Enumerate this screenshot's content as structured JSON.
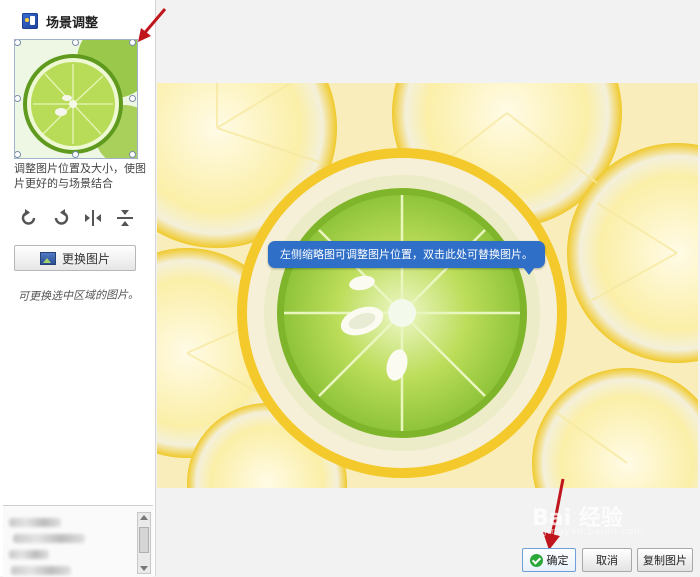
{
  "sidebar": {
    "title": "场景调整",
    "help_text": "调整图片位置及大小，使图片更好的与场景结合",
    "tools": [
      {
        "name": "rotate-left-icon"
      },
      {
        "name": "rotate-right-icon"
      },
      {
        "name": "flip-horizontal-icon"
      },
      {
        "name": "flip-vertical-icon"
      }
    ],
    "replace_button": "更换图片",
    "handwritten_note": "可更换选中区域的图片。"
  },
  "preview": {
    "tooltip": "左侧缩略图可调整图片位置，双击此处可替换图片。"
  },
  "footer": {
    "ok": "确定",
    "cancel": "取消",
    "copy": "复制图片"
  },
  "watermark": {
    "logo": "Bai  经验",
    "url": "jingyan.baidu.com"
  },
  "colors": {
    "accent": "#2f6fc7",
    "annotation_arrow": "#c0151c",
    "ok_check": "#2aa83a"
  }
}
